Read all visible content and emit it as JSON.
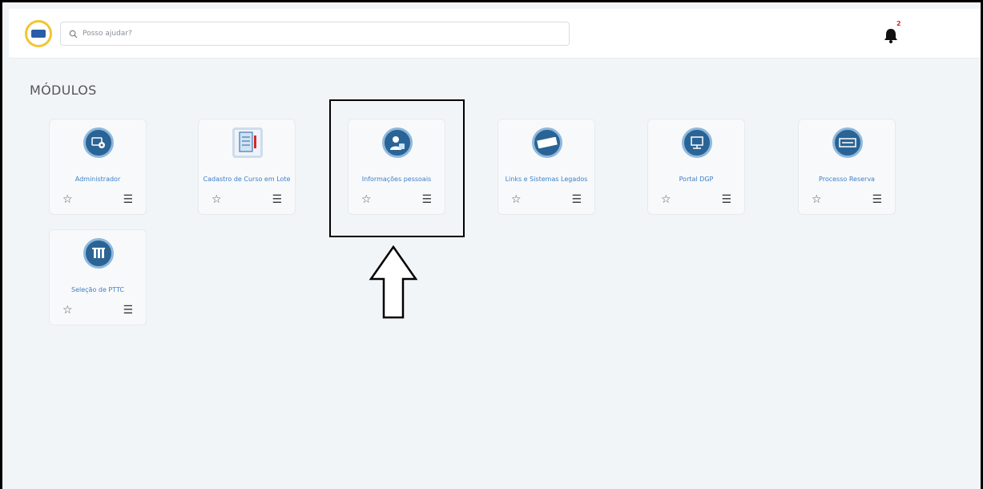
{
  "header": {
    "search_placeholder": "Posso ajudar?",
    "notification_count": "2"
  },
  "section_title": "MÓDULOS",
  "modules": [
    {
      "label": "Administrador",
      "icon": "admin-settings-icon"
    },
    {
      "label": "Cadastro de Curso em Lote",
      "icon": "document-icon"
    },
    {
      "label": "Informações pessoais",
      "icon": "personal-info-icon"
    },
    {
      "label": "Links e Sistemas Legados",
      "icon": "legacy-stamp-icon"
    },
    {
      "label": "Portal DGP",
      "icon": "portal-monitor-icon"
    },
    {
      "label": "Processo Reserva",
      "icon": "reserva-stamp-icon"
    },
    {
      "label": "Seleção de PTTC",
      "icon": "pttc-building-icon"
    }
  ],
  "colors": {
    "accent": "#3f7fc6",
    "icon_blue": "#2a6496",
    "badge": "#d62828",
    "logo_ring": "#f4c430"
  }
}
